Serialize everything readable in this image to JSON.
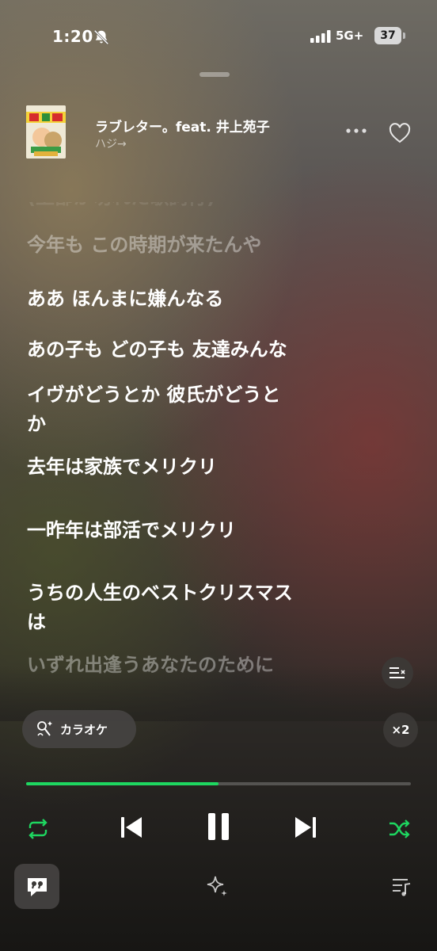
{
  "status_bar": {
    "time": "1:20",
    "network": "5G+",
    "battery": "37"
  },
  "track": {
    "title": "ラブレター。feat. 井上苑子",
    "artist": "ハジ→"
  },
  "lyrics": {
    "partial_top": "(上部が切れた歌詞行)",
    "lines": [
      "今年も この時期が来たんや",
      "ああ ほんまに嫌んなる",
      "あの子も どの子も 友達みんな",
      "イヴがどうとか 彼氏がどうと\nか",
      "去年は家族でメリクリ",
      "一昨年は部活でメリクリ",
      "うちの人生のベストクリスマス\nは",
      "いずれ出逢うあなたのために"
    ]
  },
  "karaoke_button": {
    "label": "カラオケ"
  },
  "speed_button": {
    "label": "×2"
  },
  "player": {
    "progress": 0.5
  },
  "colors": {
    "accent": "#1ed760"
  },
  "icons": [
    "mute-bell-icon",
    "more-icon",
    "heart-icon",
    "lyrics-mode-icon",
    "microphone-icon",
    "repeat-icon",
    "previous-icon",
    "pause-icon",
    "next-icon",
    "shuffle-icon",
    "quote-icon",
    "sparkle-icon",
    "queue-icon"
  ]
}
